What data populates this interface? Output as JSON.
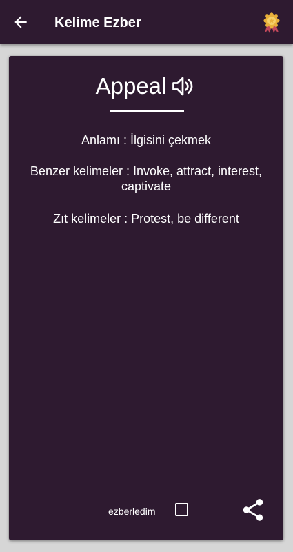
{
  "appbar": {
    "title": "Kelime Ezber",
    "back_icon": "arrow-left-icon",
    "badge_icon": "award-ribbon-icon"
  },
  "card": {
    "word": "Appeal",
    "speaker_icon": "speaker-icon",
    "meaning_line": "Anlamı : İlgisini çekmek",
    "similar_line": "Benzer kelimeler : Invoke, attract, interest, captivate",
    "opposite_line": "Zıt kelimeler : Protest, be different",
    "memorized_label": "ezberledim",
    "memorized_checked": false,
    "share_icon": "share-icon"
  },
  "colors": {
    "primary": "#2e1a30",
    "background": "#d6d6d6",
    "text": "#ffffff",
    "badge_gold": "#e8b03a",
    "badge_ribbon": "#c0475a"
  }
}
